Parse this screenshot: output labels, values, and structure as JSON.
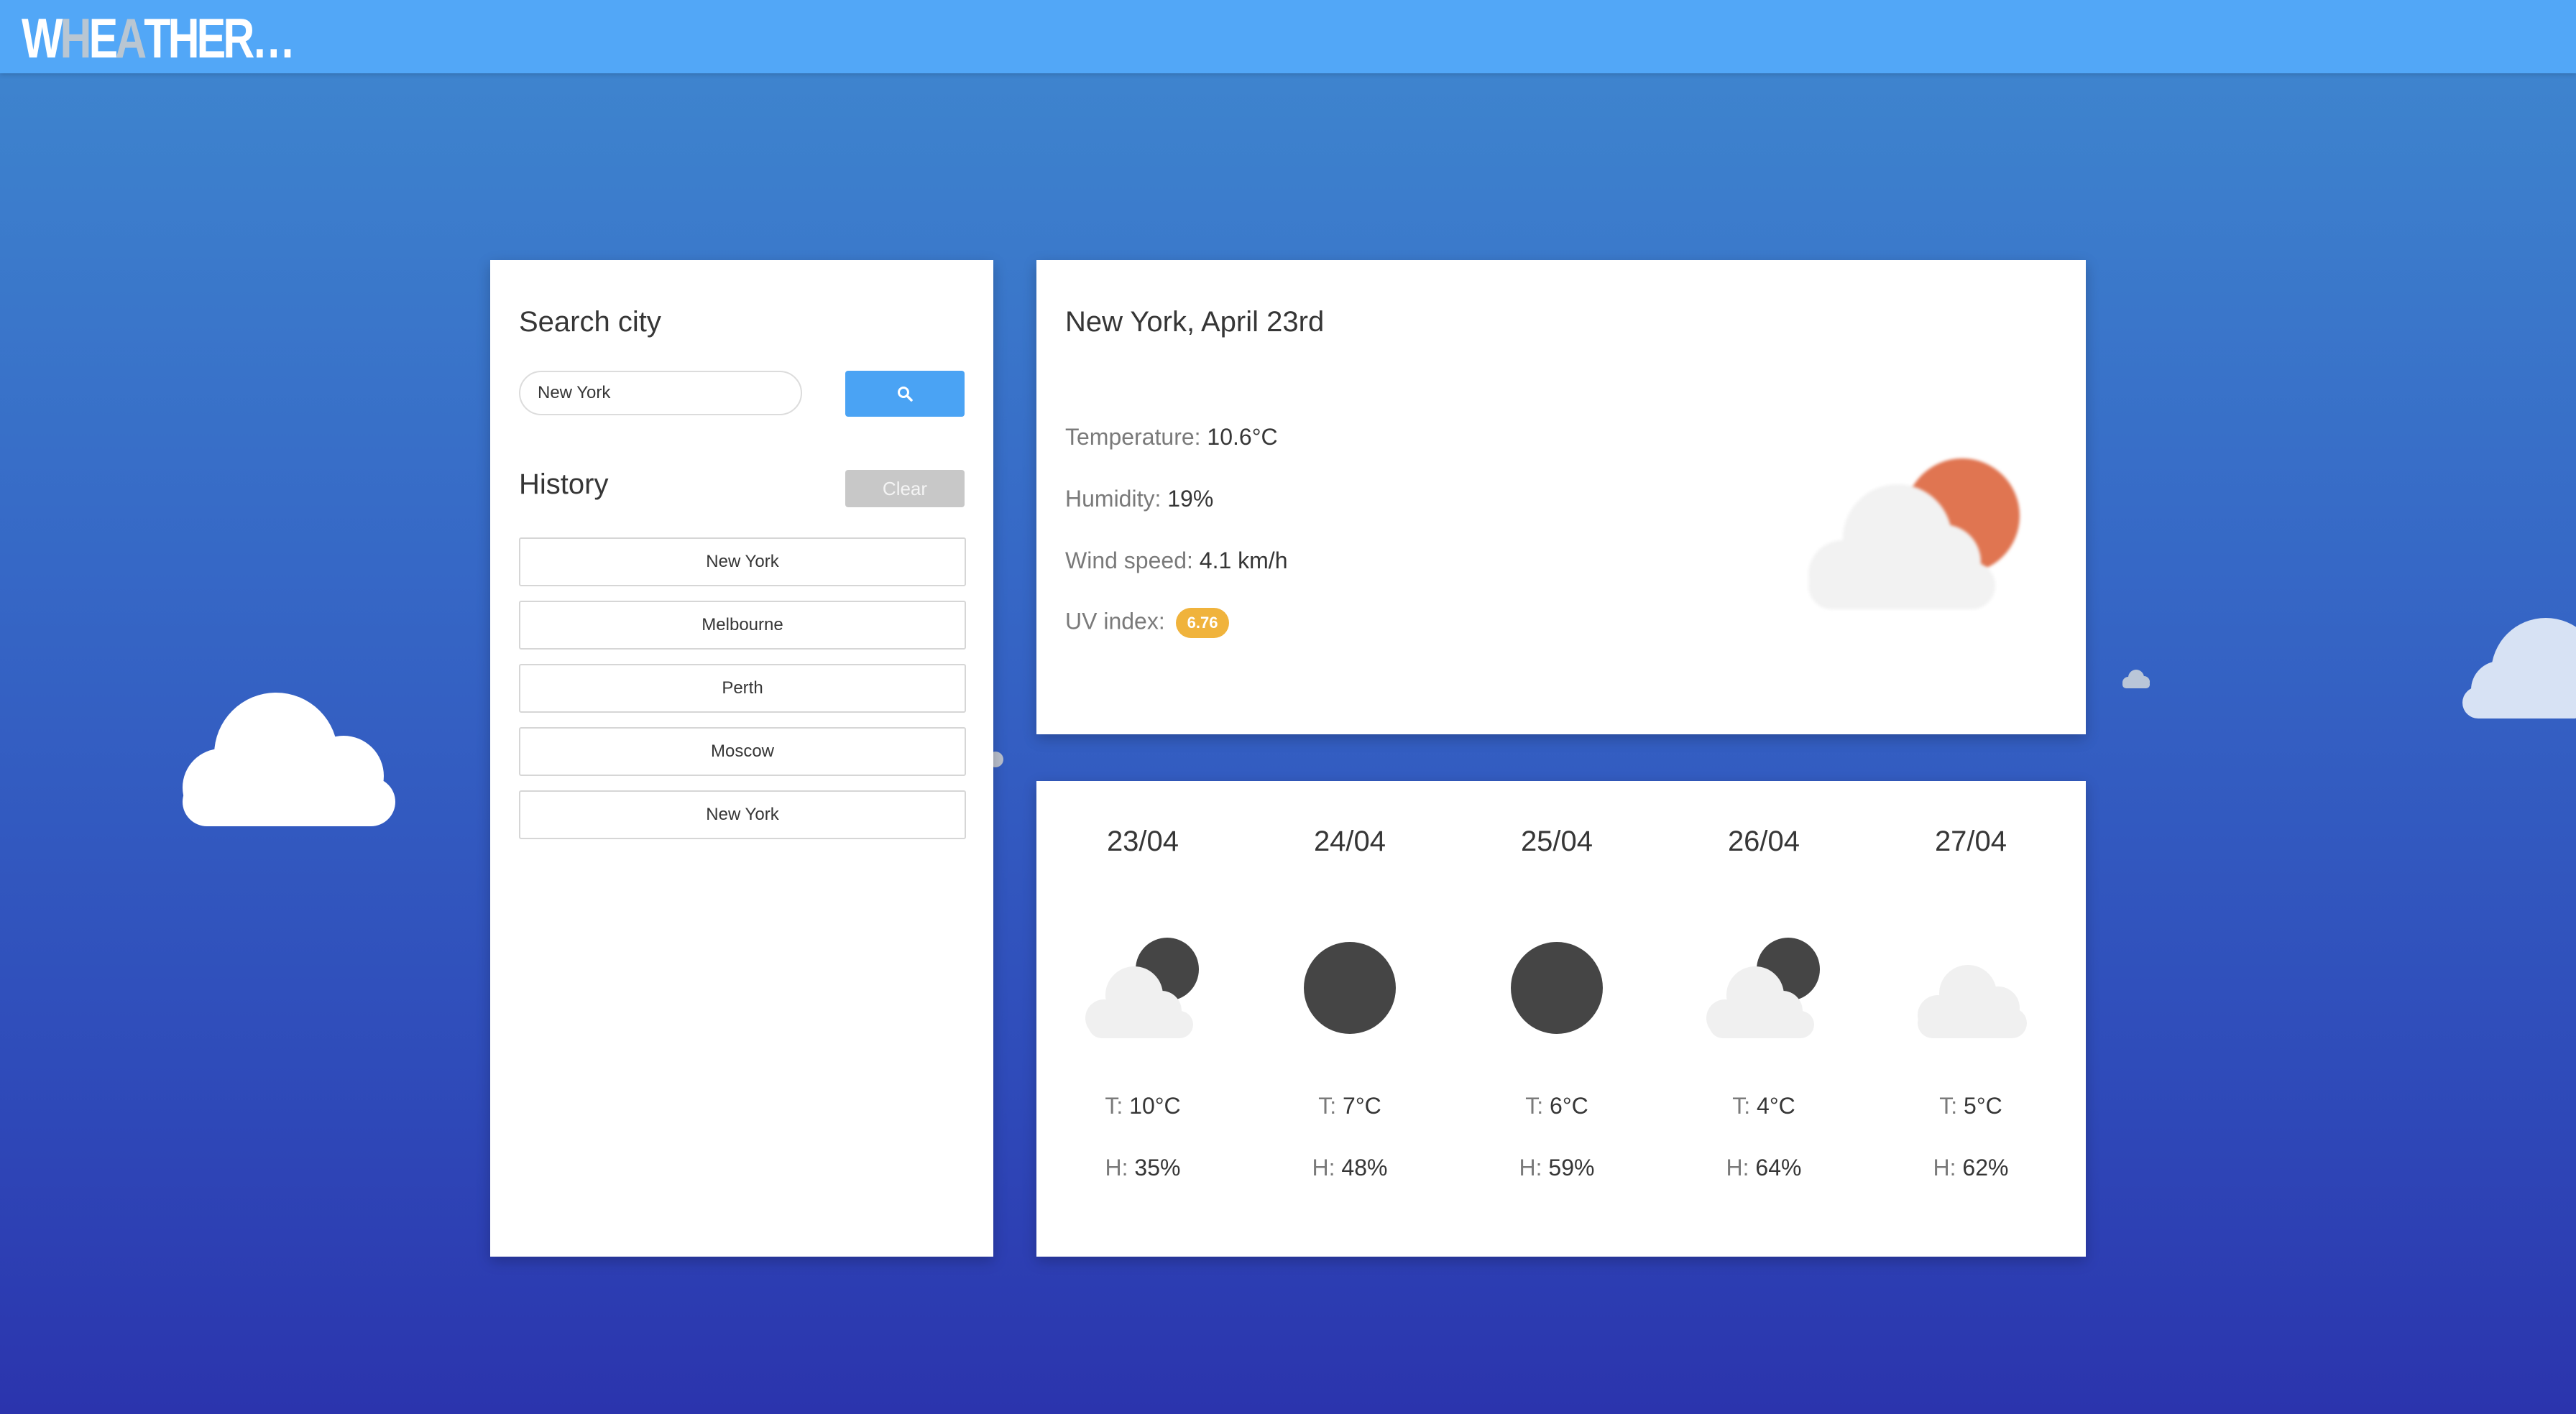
{
  "app": {
    "logo_letters": [
      "W",
      "H",
      "E",
      "A",
      "T",
      "H",
      "E",
      "R",
      "…"
    ],
    "colors": {
      "topbar": "#52a7f7",
      "accent": "#4aa3f4",
      "uv_badge": "#f0b33c",
      "sun": "#e07551",
      "moon": "#454545"
    }
  },
  "search": {
    "title": "Search city",
    "input_value": "New York",
    "button_icon": "search-icon"
  },
  "history": {
    "title": "History",
    "clear_label": "Clear",
    "items": [
      "New York",
      "Melbourne",
      "Perth",
      "Moscow",
      "New York"
    ]
  },
  "current": {
    "title": "New York, April 23rd",
    "temperature_label": "Temperature:",
    "temperature_value": "10.6°C",
    "humidity_label": "Humidity:",
    "humidity_value": "19%",
    "wind_label": "Wind speed:",
    "wind_value": "4.1 km/h",
    "uv_label": "UV index:",
    "uv_value": "6.76",
    "icon": "partly-cloudy-sun-icon"
  },
  "forecast": {
    "temp_prefix": "T:",
    "hum_prefix": "H:",
    "days": [
      {
        "date": "23/04",
        "icon": "cloud-moon-icon",
        "temp": "10°C",
        "hum": "35%"
      },
      {
        "date": "24/04",
        "icon": "moon-icon",
        "temp": "7°C",
        "hum": "48%"
      },
      {
        "date": "25/04",
        "icon": "moon-icon",
        "temp": "6°C",
        "hum": "59%"
      },
      {
        "date": "26/04",
        "icon": "cloud-moon-icon",
        "temp": "4°C",
        "hum": "64%"
      },
      {
        "date": "27/04",
        "icon": "cloud-icon",
        "temp": "5°C",
        "hum": "62%"
      }
    ]
  }
}
